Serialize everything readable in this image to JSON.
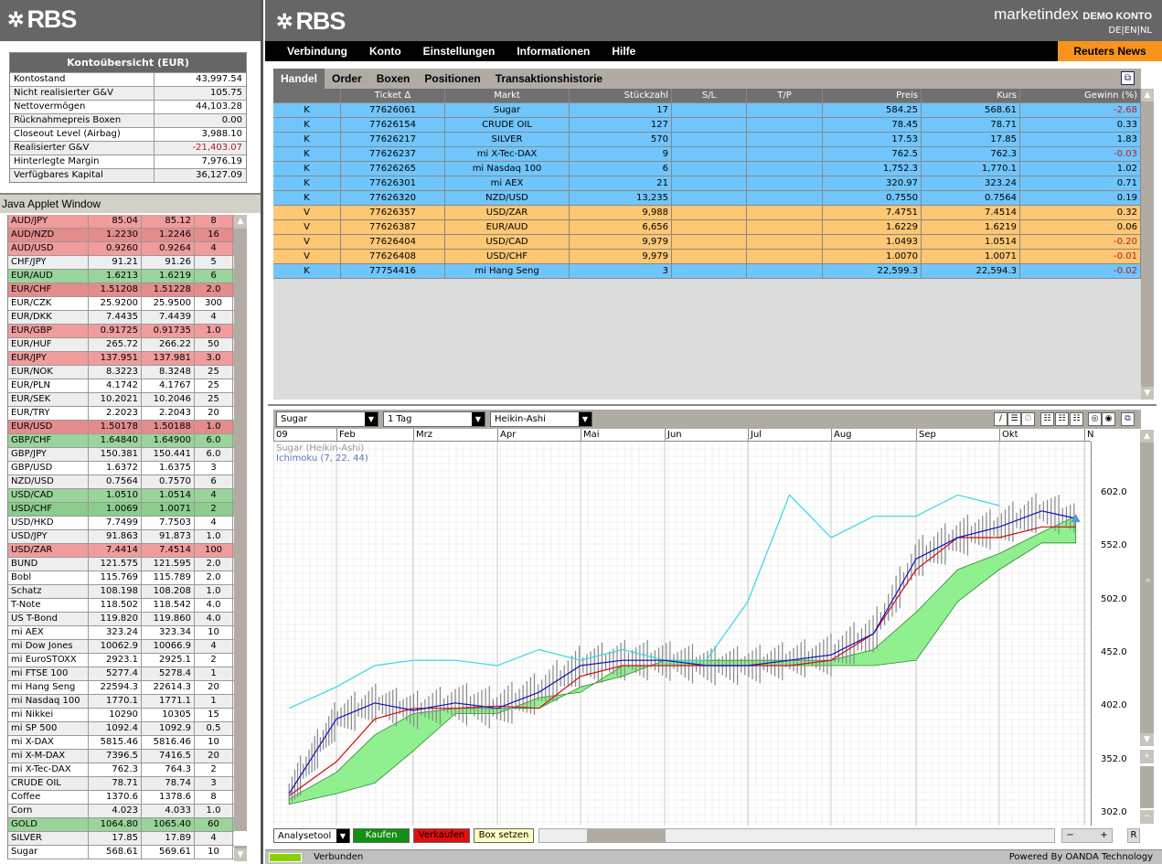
{
  "brand": {
    "logo": "RBS",
    "product": "marketindex",
    "account_type": "DEMO KONTO",
    "languages": "DE|EN|NL"
  },
  "account": {
    "title": "Kontoübersicht (EUR)",
    "rows": [
      {
        "label": "Kontostand",
        "value": "43,997.54"
      },
      {
        "label": "Nicht realisierter G&V",
        "value": "105.75"
      },
      {
        "label": "Nettovermögen",
        "value": "44,103.28"
      },
      {
        "label": "Rücknahmepreis Boxen",
        "value": "0.00"
      },
      {
        "label": "Closeout Level (Airbag)",
        "value": "3,988.10"
      },
      {
        "label": "Realisierter G&V",
        "value": "-21,403.07",
        "negative": true
      },
      {
        "label": "Hinterlegte Margin",
        "value": "7,976.19"
      },
      {
        "label": "Verfügbares Kapital",
        "value": "36,127.09"
      }
    ]
  },
  "java_window_label": "Java Applet Window",
  "quotes": [
    [
      "AUD/JPY",
      "85.04",
      "85.12",
      "8",
      "r"
    ],
    [
      "AUD/NZD",
      "1.2230",
      "1.2246",
      "16",
      "rd"
    ],
    [
      "AUD/USD",
      "0.9260",
      "0.9264",
      "4",
      "r"
    ],
    [
      "CHF/JPY",
      "91.21",
      "91.26",
      "5",
      "g"
    ],
    [
      "EUR/AUD",
      "1.6213",
      "1.6219",
      "6",
      "gr"
    ],
    [
      "EUR/CHF",
      "1.51208",
      "1.51228",
      "2.0",
      "rd"
    ],
    [
      "EUR/CZK",
      "25.9200",
      "25.9500",
      "300",
      "w"
    ],
    [
      "EUR/DKK",
      "7.4435",
      "7.4439",
      "4",
      "g"
    ],
    [
      "EUR/GBP",
      "0.91725",
      "0.91735",
      "1.0",
      "r"
    ],
    [
      "EUR/HUF",
      "265.72",
      "266.22",
      "50",
      "g"
    ],
    [
      "EUR/JPY",
      "137.951",
      "137.981",
      "3.0",
      "r"
    ],
    [
      "EUR/NOK",
      "8.3223",
      "8.3248",
      "25",
      "g"
    ],
    [
      "EUR/PLN",
      "4.1742",
      "4.1767",
      "25",
      "w"
    ],
    [
      "EUR/SEK",
      "10.2021",
      "10.2046",
      "25",
      "g"
    ],
    [
      "EUR/TRY",
      "2.2023",
      "2.2043",
      "20",
      "w"
    ],
    [
      "EUR/USD",
      "1.50178",
      "1.50188",
      "1.0",
      "rd"
    ],
    [
      "GBP/CHF",
      "1.64840",
      "1.64900",
      "6.0",
      "gr"
    ],
    [
      "GBP/JPY",
      "150.381",
      "150.441",
      "6.0",
      "g"
    ],
    [
      "GBP/USD",
      "1.6372",
      "1.6375",
      "3",
      "w"
    ],
    [
      "NZD/USD",
      "0.7564",
      "0.7570",
      "6",
      "g"
    ],
    [
      "USD/CAD",
      "1.0510",
      "1.0514",
      "4",
      "gr"
    ],
    [
      "USD/CHF",
      "1.0069",
      "1.0071",
      "2",
      "grd"
    ],
    [
      "USD/HKD",
      "7.7499",
      "7.7503",
      "4",
      "w"
    ],
    [
      "USD/JPY",
      "91.863",
      "91.873",
      "1.0",
      "g"
    ],
    [
      "USD/ZAR",
      "7.4414",
      "7.4514",
      "100",
      "r"
    ],
    [
      "BUND",
      "121.575",
      "121.595",
      "2.0",
      "g"
    ],
    [
      "Bobl",
      "115.769",
      "115.789",
      "2.0",
      "w"
    ],
    [
      "Schatz",
      "108.198",
      "108.208",
      "1.0",
      "g"
    ],
    [
      "T-Note",
      "118.502",
      "118.542",
      "4.0",
      "w"
    ],
    [
      "US T-Bond",
      "119.820",
      "119.860",
      "4.0",
      "g"
    ],
    [
      "mi AEX",
      "323.24",
      "323.34",
      "10",
      "w"
    ],
    [
      "mi Dow Jones",
      "10062.9",
      "10066.9",
      "4",
      "g"
    ],
    [
      "mi EuroSTOXX",
      "2923.1",
      "2925.1",
      "2",
      "w"
    ],
    [
      "mi FTSE 100",
      "5277.4",
      "5278.4",
      "1",
      "g"
    ],
    [
      "mi Hang Seng",
      "22594.3",
      "22614.3",
      "20",
      "w"
    ],
    [
      "mi Nasdaq 100",
      "1770.1",
      "1771.1",
      "1",
      "g"
    ],
    [
      "mi Nikkei",
      "10290",
      "10305",
      "15",
      "w"
    ],
    [
      "mi SP 500",
      "1092.4",
      "1092.9",
      "0.5",
      "g"
    ],
    [
      "mi X-DAX",
      "5815.46",
      "5816.46",
      "10",
      "w"
    ],
    [
      "mi X-M-DAX",
      "7396.5",
      "7416.5",
      "20",
      "g"
    ],
    [
      "mi X-Tec-DAX",
      "762.3",
      "764.3",
      "2",
      "w"
    ],
    [
      "CRUDE OIL",
      "78.71",
      "78.74",
      "3",
      "g"
    ],
    [
      "Coffee",
      "1370.6",
      "1378.6",
      "8",
      "w"
    ],
    [
      "Corn",
      "4.023",
      "4.033",
      "1.0",
      "g"
    ],
    [
      "GOLD",
      "1064.80",
      "1065.40",
      "60",
      "gr"
    ],
    [
      "SILVER",
      "17.85",
      "17.89",
      "4",
      "g"
    ],
    [
      "Sugar",
      "568.61",
      "569.61",
      "10",
      "w"
    ]
  ],
  "menu": [
    "Verbindung",
    "Konto",
    "Einstellungen",
    "Informationen",
    "Hilfe"
  ],
  "reuters_label": "Reuters News",
  "tabs": [
    "Handel",
    "Order",
    "Boxen",
    "Positionen",
    "Transaktionshistorie"
  ],
  "positions": {
    "headers": [
      "",
      "Ticket  ∆",
      "Markt",
      "Stückzahl",
      "S/L",
      "T/P",
      "Preis",
      "Kurs",
      "Gewinn (%)"
    ],
    "rows": [
      [
        "K",
        "77626061",
        "Sugar",
        "17",
        "",
        "",
        "584.25",
        "568.61",
        "-2.68"
      ],
      [
        "K",
        "77626154",
        "CRUDE OIL",
        "127",
        "",
        "",
        "78.45",
        "78.71",
        "0.33"
      ],
      [
        "K",
        "77626217",
        "SILVER",
        "570",
        "",
        "",
        "17.53",
        "17.85",
        "1.83"
      ],
      [
        "K",
        "77626237",
        "mi X-Tec-DAX",
        "9",
        "",
        "",
        "762.5",
        "762.3",
        "-0.03"
      ],
      [
        "K",
        "77626265",
        "mi Nasdaq 100",
        "6",
        "",
        "",
        "1,752.3",
        "1,770.1",
        "1.02"
      ],
      [
        "K",
        "77626301",
        "mi AEX",
        "21",
        "",
        "",
        "320.97",
        "323.24",
        "0.71"
      ],
      [
        "K",
        "77626320",
        "NZD/USD",
        "13,235",
        "",
        "",
        "0.7550",
        "0.7564",
        "0.19"
      ],
      [
        "V",
        "77626357",
        "USD/ZAR",
        "9,988",
        "",
        "",
        "7.4751",
        "7.4514",
        "0.32"
      ],
      [
        "V",
        "77626387",
        "EUR/AUD",
        "6,656",
        "",
        "",
        "1.6229",
        "1.6219",
        "0.06"
      ],
      [
        "V",
        "77626404",
        "USD/CAD",
        "9,979",
        "",
        "",
        "1.0493",
        "1.0514",
        "-0.20"
      ],
      [
        "V",
        "77626408",
        "USD/CHF",
        "9,979",
        "",
        "",
        "1.0070",
        "1.0071",
        "-0.01"
      ],
      [
        "K",
        "77754416",
        "mi Hang Seng",
        "3",
        "",
        "",
        "22,599.3",
        "22,594.3",
        "-0.02"
      ]
    ]
  },
  "chart_toolbar": {
    "instrument": "Sugar",
    "interval": "1 Tag",
    "style": "Heikin-Ashi"
  },
  "chart_data": {
    "type": "line",
    "legend": [
      "Sugar (Heikin-Ashi)",
      "Ichimoku (7, 22, 44)"
    ],
    "month_labels": [
      "09",
      "Feb",
      "Mrz",
      "Apr",
      "Mai",
      "Jun",
      "Jul",
      "Aug",
      "Sep",
      "Okt",
      "N"
    ],
    "yticks": [
      302.0,
      352.0,
      402.0,
      452.0,
      502.0,
      552.0,
      602.0
    ],
    "ylim": [
      290,
      650
    ],
    "x": [
      0.25,
      1,
      1.5,
      2,
      2.5,
      3,
      3.5,
      4,
      4.5,
      5,
      5.5,
      6,
      6.5,
      7,
      7.5,
      8,
      8.5,
      9,
      9.5,
      9.9
    ],
    "series": [
      {
        "name": "tenkan",
        "color": "#1010c0",
        "values": [
          320,
          390,
          405,
          398,
          405,
          400,
          415,
          440,
          445,
          445,
          440,
          440,
          445,
          450,
          470,
          540,
          560,
          570,
          585,
          578
        ]
      },
      {
        "name": "kijun",
        "color": "#d01010",
        "values": [
          318,
          350,
          390,
          400,
          400,
          402,
          400,
          430,
          440,
          440,
          440,
          440,
          440,
          445,
          470,
          530,
          560,
          560,
          570,
          570
        ]
      },
      {
        "name": "chikou",
        "color": "#30d8e8",
        "values": [
          400,
          420,
          440,
          445,
          445,
          440,
          455,
          445,
          455,
          445,
          445,
          500,
          600,
          560,
          580,
          580,
          600,
          590,
          null,
          null
        ]
      },
      {
        "name": "cloud_upper",
        "color": "#90f090",
        "values": [
          315,
          340,
          375,
          395,
          400,
          400,
          400,
          420,
          430,
          445,
          445,
          445,
          445,
          445,
          455,
          490,
          530,
          545,
          565,
          580
        ]
      },
      {
        "name": "cloud_lower",
        "color": "#90f090",
        "values": [
          310,
          320,
          330,
          360,
          395,
          395,
          410,
          415,
          440,
          440,
          440,
          440,
          440,
          440,
          440,
          445,
          500,
          530,
          555,
          555
        ]
      }
    ]
  },
  "bottom_toolbar": {
    "analysis": "Analysetool",
    "buy": "Kaufen",
    "sell": "Verkaufen",
    "box": "Box setzen",
    "reset": "R"
  },
  "status": {
    "connection": "Verbunden",
    "powered_by": "Powered By OANDA Technology"
  }
}
